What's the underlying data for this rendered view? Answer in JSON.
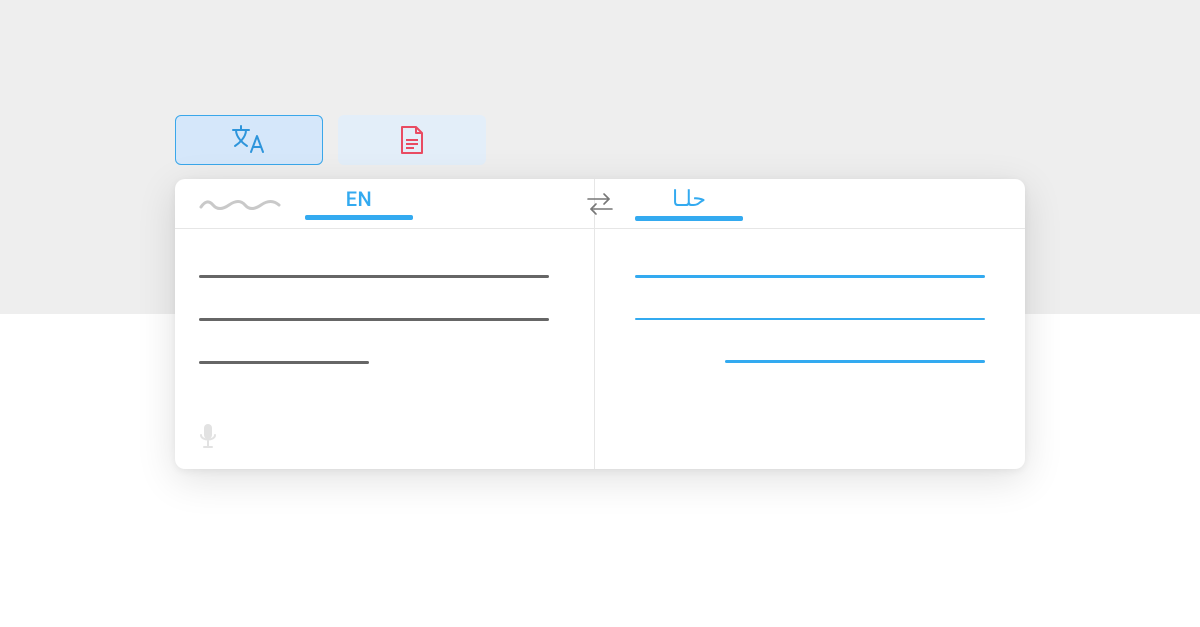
{
  "tabs": {
    "translate_icon": "translate-icon",
    "document_icon": "document-icon"
  },
  "source": {
    "lang_label": "EN"
  },
  "target": {
    "lang_label": "حلـا"
  },
  "colors": {
    "accent": "#33aaf0",
    "tab_active_bg": "#d5e7fa",
    "tab_inactive_bg": "#e3eef9",
    "doc_icon": "#e94b62",
    "text_line": "#666666",
    "page_top_bg": "#eeeeee"
  }
}
